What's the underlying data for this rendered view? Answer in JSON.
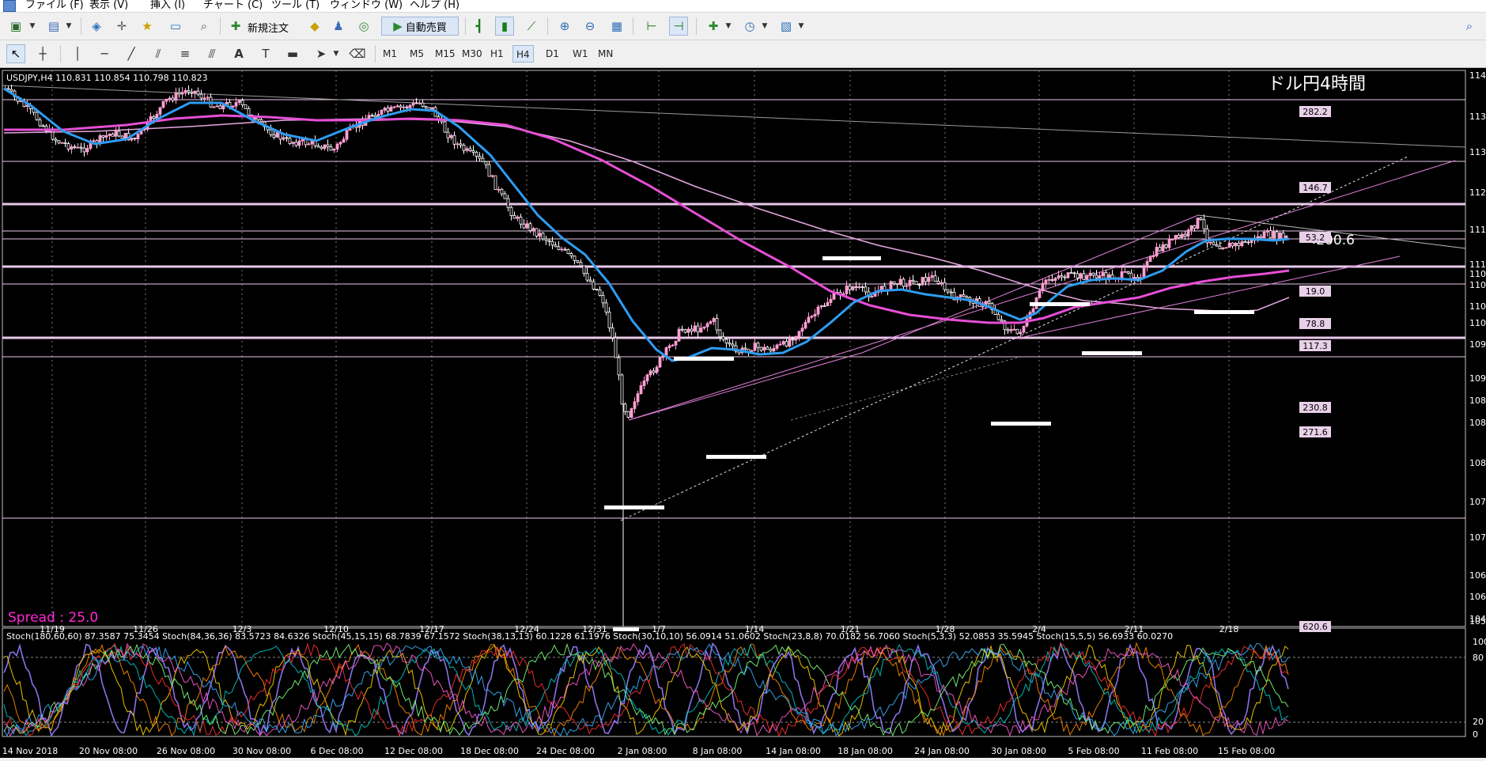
{
  "menu": [
    "ファイル (F)",
    "表示 (V)",
    "挿入 (I)",
    "チャート (C)",
    "ツール (T)",
    "ウィンドウ (W)",
    "ヘルプ (H)"
  ],
  "toolbar": {
    "new_order_label": "新規注文",
    "auto_trading_label": "自動売買",
    "timeframes": [
      "M1",
      "M5",
      "M15",
      "M30",
      "H1",
      "H4",
      "D1",
      "W1",
      "MN"
    ],
    "active_timeframe": "H4"
  },
  "chart": {
    "header": "USDJPY,H4  110.831 110.854 110.798 110.823",
    "overlay_title": "ドル円4時間",
    "spread_text": "Spread : 25.0",
    "pips_marker": "<200.6",
    "price_ticks": [
      "114",
      "113",
      "113",
      "112",
      "111",
      "111",
      "110",
      "110",
      "110",
      "110",
      "109",
      "109",
      "108",
      "108",
      "108",
      "107",
      "107",
      "106",
      "106",
      "105",
      "104"
    ],
    "level_labels": [
      "282.2",
      "146.7",
      "53.2",
      "19.0",
      "78.8",
      "117.3",
      "230.8",
      "271.6",
      "620.6"
    ],
    "top_date_labels": [
      "11/19",
      "11/26",
      "12/3",
      "12/10",
      "12/17",
      "12/24",
      "12/31",
      "1/7",
      "1/14",
      "1/21",
      "1/28",
      "2/4",
      "2/11",
      "2/18"
    ],
    "bottom_date_labels": [
      "14 Nov 2018",
      "20 Nov 08:00",
      "26 Nov 08:00",
      "30 Nov 08:00",
      "6 Dec 08:00",
      "12 Dec 08:00",
      "18 Dec 08:00",
      "24 Dec 08:00",
      "2 Jan 08:00",
      "8 Jan 08:00",
      "14 Jan 08:00",
      "18 Jan 08:00",
      "24 Jan 08:00",
      "30 Jan 08:00",
      "5 Feb 08:00",
      "11 Feb 08:00",
      "15 Feb 08:00"
    ],
    "colors": {
      "bull": "#ff9ed2",
      "bear": "#ffffff",
      "ma_fast": "#2f9cf0",
      "ma_mid": "#e64fd6",
      "ma_slow": "#e6a8e0",
      "spread": "#ff2bd6",
      "level_line": "#e8c8e8"
    }
  },
  "indicator": {
    "header": "Stoch(180,60,60) 87.3587 75.3454  Stoch(84,36,36) 83.5723 84.6326  Stoch(45,15,15) 68.7839 67.1572  Stoch(38,13,13) 60.1228 61.1976  Stoch(30,10,10) 56.0914 51.0602  Stoch(23,8,8) 70.0182 56.7060  Stoch(5,3,3) 52.0853 35.5945  Stoch(15,5,5) 56.6933 60.0270",
    "levels": [
      "100",
      "80",
      "20",
      "0"
    ]
  }
}
